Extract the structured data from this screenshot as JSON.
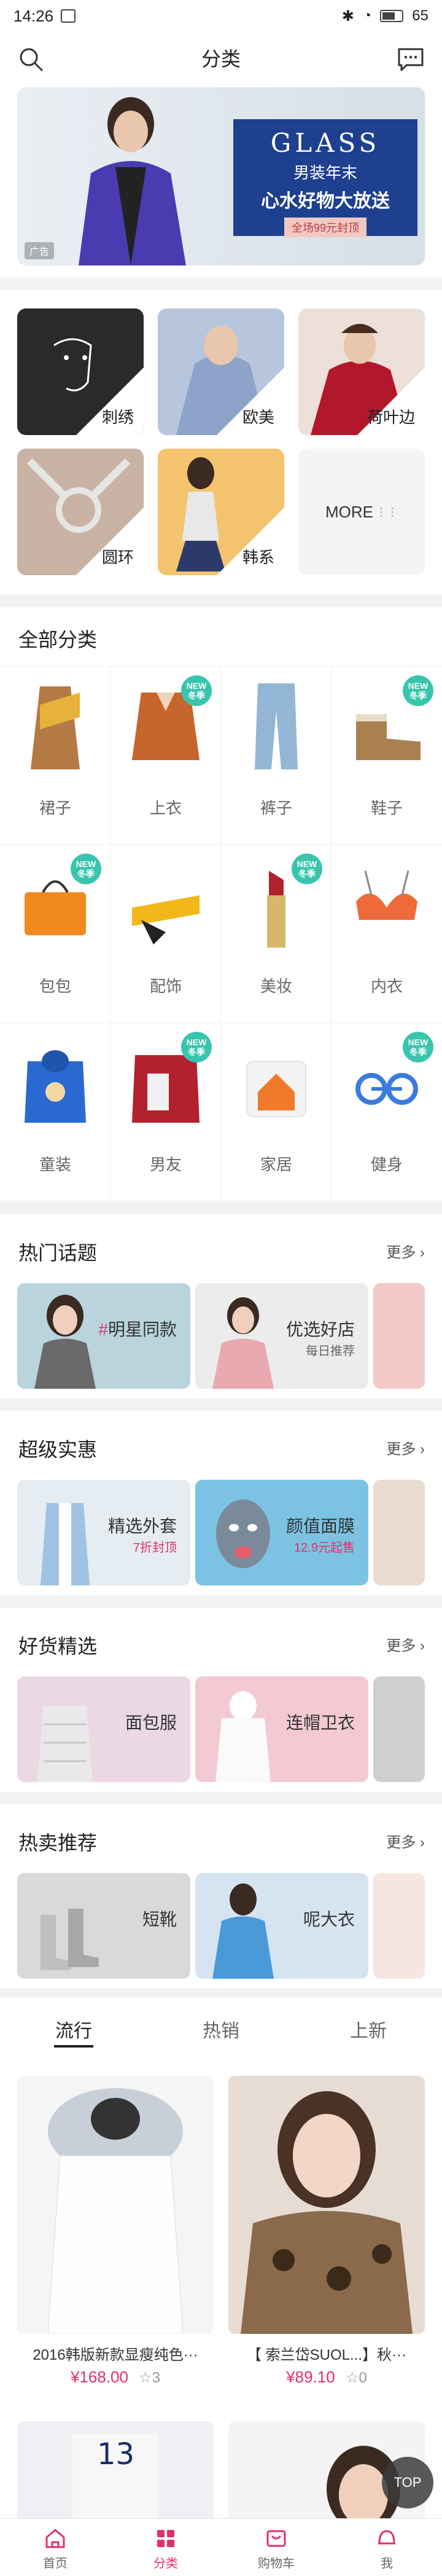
{
  "status_bar": {
    "time": "14:26",
    "battery": "65"
  },
  "header": {
    "title": "分类"
  },
  "banner": {
    "headline": "GLASS",
    "line1": "男装年末",
    "line2": "心水好物大放送",
    "tag": "全场99元封顶",
    "ad_label": "广告",
    "card_color": "#1f3f8f"
  },
  "styles": [
    {
      "label": "刺绣"
    },
    {
      "label": "欧美"
    },
    {
      "label": "荷叶边"
    },
    {
      "label": "圆环"
    },
    {
      "label": "韩系"
    },
    {
      "label": "MORE"
    }
  ],
  "all_categories": {
    "title": "全部分类",
    "new_badge": "NEW\n冬季",
    "items": [
      {
        "label": "裙子",
        "new": false
      },
      {
        "label": "上衣",
        "new": true
      },
      {
        "label": "裤子",
        "new": false
      },
      {
        "label": "鞋子",
        "new": true
      },
      {
        "label": "包包",
        "new": true
      },
      {
        "label": "配饰",
        "new": false
      },
      {
        "label": "美妆",
        "new": true
      },
      {
        "label": "内衣",
        "new": false
      },
      {
        "label": "童装",
        "new": false
      },
      {
        "label": "男友",
        "new": true
      },
      {
        "label": "家居",
        "new": false
      },
      {
        "label": "健身",
        "new": true
      }
    ]
  },
  "hot_topics": {
    "title": "热门话题",
    "more": "更多",
    "cards": [
      {
        "text": "明星同款",
        "prefix": "#"
      },
      {
        "text": "优选好店",
        "sub": "每日推荐"
      }
    ]
  },
  "deals": {
    "title": "超级实惠",
    "more": "更多",
    "cards": [
      {
        "text": "精选外套",
        "sub": "7折封顶"
      },
      {
        "text": "颜值面膜",
        "sub": "12.9元起售"
      }
    ]
  },
  "good_picks": {
    "title": "好货精选",
    "more": "更多",
    "cards": [
      {
        "text": "面包服"
      },
      {
        "text": "连帽卫衣"
      }
    ]
  },
  "hot_sale": {
    "title": "热卖推荐",
    "more": "更多",
    "cards": [
      {
        "text": "短靴"
      },
      {
        "text": "呢大衣"
      }
    ]
  },
  "tabs": [
    "流行",
    "热销",
    "上新"
  ],
  "products": [
    {
      "name": "2016韩版新款显瘦纯色···",
      "price": "¥168.00",
      "favorites": "3"
    },
    {
      "name": "【 索兰岱SUOL...】秋···",
      "price": "¥89.10",
      "favorites": "0"
    }
  ],
  "top_button": "TOP",
  "bottom_nav": [
    {
      "label": "首页",
      "icon": "home-icon"
    },
    {
      "label": "分类",
      "icon": "category-icon"
    },
    {
      "label": "购物车",
      "icon": "cart-icon"
    },
    {
      "label": "我",
      "icon": "user-icon"
    }
  ],
  "colors": {
    "accent": "#e0306c",
    "badge": "#39c5ad"
  }
}
